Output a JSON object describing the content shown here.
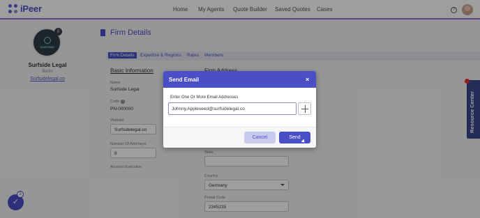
{
  "app": {
    "brand": "iPeer"
  },
  "nav": {
    "items": [
      "Home",
      "My Agents",
      "Quote Builder",
      "Saved Quotes",
      "Cases"
    ],
    "help_icon": "help-circle-icon",
    "avatar_icon": "user-avatar"
  },
  "profile": {
    "logo_text": "SURFSIDE",
    "name": "Surfside Legal",
    "city": "Berlin",
    "website": "Surfsidelegal.co"
  },
  "page": {
    "title": "Firm Details",
    "tabs": [
      "Firm Details",
      "Expertise & Regions",
      "Rates",
      "Members"
    ]
  },
  "basic_info": {
    "title": "Basic Information",
    "name_label": "Name",
    "name_value": "Surfside Legal",
    "code_label": "Code",
    "code_value": "PN-000000",
    "website_label": "Website",
    "website_value": "Surfsidelegal.co",
    "attorneys_label": "Number Of Attorneys",
    "attorneys_value": "8",
    "executive_label": "Account Executive"
  },
  "firm_address": {
    "title": "Firm Address",
    "state_label": "State",
    "country_label": "Country",
    "country_value": "Germany",
    "postal_label": "Postal Code",
    "postal_value": "2345235"
  },
  "resource_center": {
    "label": "Resource Center"
  },
  "fab": {
    "count": "3",
    "icon": "check-icon"
  },
  "modal": {
    "title": "Send Email",
    "close": "×",
    "field_label": "Enter One Or More Email Addresses",
    "email_value": "Johnny.Appleseed@surfsidelegal.co",
    "cancel_label": "Cancel",
    "send_label": "Send"
  },
  "colors": {
    "primary": "#4a4fc7",
    "overlay": "rgba(0,0,0,0.38)",
    "resource": "#3a4a8f"
  }
}
